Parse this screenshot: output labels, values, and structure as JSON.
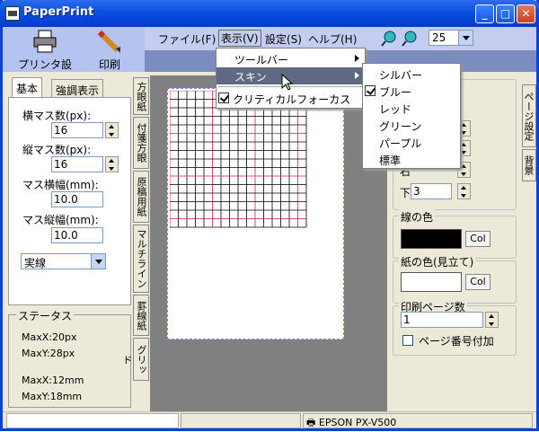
{
  "window": {
    "title": "PaperPrint",
    "min": "_",
    "max": "□",
    "close": "✕"
  },
  "toolbar": {
    "printer_setup": "プリンタ設定",
    "print": "印刷"
  },
  "menubar": {
    "items": [
      "ファイル(F)",
      "表示(V)",
      "設定(S)",
      "ヘルプ(H)"
    ]
  },
  "zoom": {
    "value": "25"
  },
  "left": {
    "tabs": [
      "基本",
      "強調表示"
    ],
    "h_count_label": "横マス数(px):",
    "h_count": "16",
    "v_count_label": "縦マス数(px):",
    "v_count": "16",
    "cell_w_label": "マス横幅(mm):",
    "cell_w": "10.0",
    "cell_h_label": "マス縦幅(mm):",
    "cell_h": "10.0",
    "line_style": "実線",
    "status_title": "ステータス",
    "status": [
      "MaxX:20px",
      "MaxY:28px",
      "MaxX:12mm",
      "MaxY:18mm"
    ]
  },
  "vtabs": [
    "方眼紙",
    "付箋方眼",
    "原稿用紙",
    "マルチライン",
    "罫線紙",
    "グリッド"
  ],
  "right": {
    "vtabs": [
      "ページ設定",
      "背景"
    ],
    "bottom_label": "下",
    "bottom_value": "3",
    "right_label": "右",
    "line_color": "線の色",
    "col": "Col",
    "paper_color": "紙の色(見立て)",
    "print_pages": "印刷ページ数",
    "pages_value": "1",
    "page_number": "ページ番号付加"
  },
  "dropdown": {
    "items": [
      "ツールバー",
      "スキン",
      "クリティカルフォーカス"
    ]
  },
  "skins": {
    "items": [
      "シルバー",
      "ブルー",
      "レッド",
      "グリーン",
      "パープル",
      "標準"
    ]
  },
  "statusbar": {
    "printer": "EPSON PX-V500"
  },
  "colors": {
    "accent": "#0842d6",
    "line": "#cc2244",
    "highlight": "#5f6a82"
  }
}
